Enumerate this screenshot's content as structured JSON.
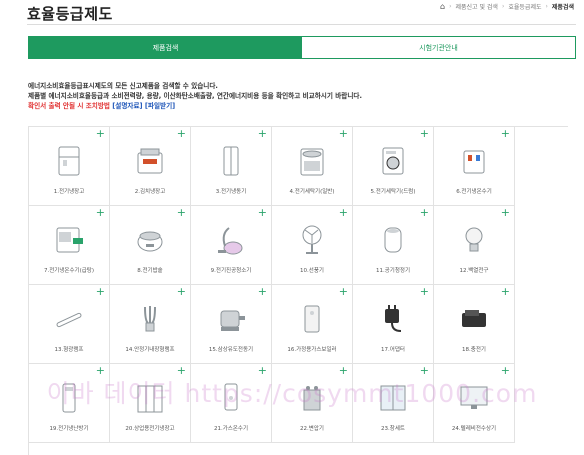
{
  "header": {
    "title": "효율등급제도",
    "breadcrumb": [
      "제품신고 및 검색",
      "효율등급제도",
      "제품검색"
    ]
  },
  "tabs": [
    {
      "label": "제품검색",
      "active": true
    },
    {
      "label": "시험기관안내",
      "active": false
    }
  ],
  "intro": {
    "line1": "에너지소비효율등급표시제도의 모든 신고제품을 검색할 수 있습니다.",
    "line2": "제품별 에너지소비효율등급과 소비전력량, 용량, 이산화탄소배출량, 연간에너지비용 등을 확인하고 비교하시기 바랍니다.",
    "line3_text": "확인서 출력 안될 시 조치방법",
    "link1": "[설명자료]",
    "link2": "[파일받기]"
  },
  "products": [
    {
      "label": "1.전기냉장고",
      "icon": "refrigerator-icon"
    },
    {
      "label": "2.김치냉장고",
      "icon": "kimchi-fridge-icon"
    },
    {
      "label": "3.전기냉동기",
      "icon": "freezer-icon"
    },
    {
      "label": "4.전기세탁기(일반)",
      "icon": "washing-machine-icon"
    },
    {
      "label": "5.전기세탁기(드럼)",
      "icon": "drum-washer-icon"
    },
    {
      "label": "6.전기냉온수기",
      "icon": "water-cooler-icon"
    },
    {
      "label": "7.전기냉온수기(급탕)",
      "icon": "water-dispenser-icon"
    },
    {
      "label": "8.전기밥솥",
      "icon": "rice-cooker-icon"
    },
    {
      "label": "9.전기진공청소기",
      "icon": "vacuum-cleaner-icon"
    },
    {
      "label": "10.선풍기",
      "icon": "fan-icon"
    },
    {
      "label": "11.공기청정기",
      "icon": "air-purifier-icon"
    },
    {
      "label": "12.백열전구",
      "icon": "light-bulb-icon"
    },
    {
      "label": "13.형광램프",
      "icon": "fluorescent-lamp-icon"
    },
    {
      "label": "14.안정기내장형램프",
      "icon": "cfl-lamp-icon"
    },
    {
      "label": "15.삼상유도전동기",
      "icon": "motor-icon"
    },
    {
      "label": "16.가정용가스보일러",
      "icon": "gas-boiler-icon"
    },
    {
      "label": "17.어댑터",
      "icon": "adapter-icon"
    },
    {
      "label": "18.충전기",
      "icon": "charger-icon"
    },
    {
      "label": "19.전기냉난방기",
      "icon": "air-conditioner-icon"
    },
    {
      "label": "20.상업용전기냉장고",
      "icon": "commercial-fridge-icon"
    },
    {
      "label": "21.가스온수기",
      "icon": "gas-water-heater-icon"
    },
    {
      "label": "22.변압기",
      "icon": "transformer-icon"
    },
    {
      "label": "23.창세트",
      "icon": "window-set-icon"
    },
    {
      "label": "24.텔레비전수상기",
      "icon": "television-icon"
    }
  ],
  "watermark": "이바 데이터 https://cosymmt1000.com",
  "colors": {
    "accent": "#1e9a5f",
    "notice": "#e03030",
    "link": "#1c54b8"
  }
}
